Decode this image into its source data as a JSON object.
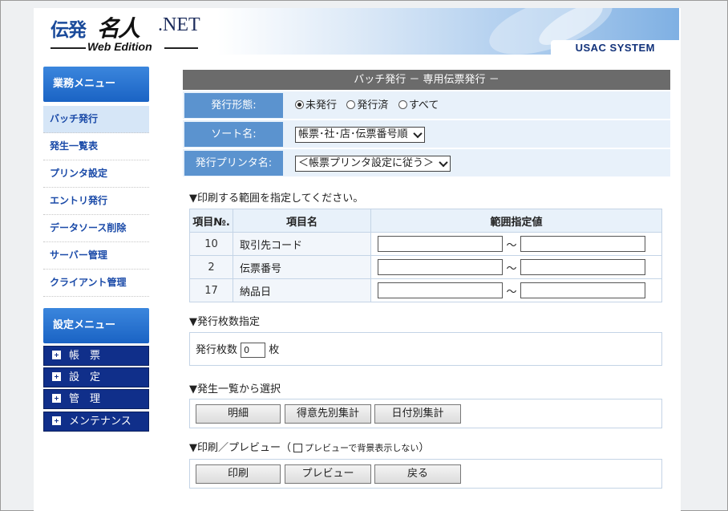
{
  "header": {
    "logo_dept": "伝発",
    "logo_meijin": "名人",
    "logo_net": ".NET",
    "logo_edition": "Web Edition",
    "brand": "USAC SYSTEM"
  },
  "sidebar": {
    "work_menu_title": "業務メニュー",
    "work_items": [
      {
        "label": "バッチ発行",
        "active": true
      },
      {
        "label": "発生一覧表"
      },
      {
        "label": "プリンタ設定"
      },
      {
        "label": "エントリ発行"
      },
      {
        "label": "データソース削除"
      },
      {
        "label": "サーバー管理"
      },
      {
        "label": "クライアント管理"
      }
    ],
    "settings_menu_title": "設定メニュー",
    "settings_items": [
      {
        "label": "帳　票"
      },
      {
        "label": "設　定"
      },
      {
        "label": "管　理"
      },
      {
        "label": "メンテナンス"
      }
    ]
  },
  "main": {
    "title": "バッチ発行 － 専用伝票発行 －",
    "options": {
      "issue_form_label": "発行形態:",
      "issue_radio": [
        "未発行",
        "発行済",
        "すべて"
      ],
      "issue_selected": "未発行",
      "sort_label": "ソート名:",
      "sort_value": "帳票･社･店･伝票番号順",
      "printer_label": "発行プリンタ名:",
      "printer_value": "＜帳票プリンタ設定に従う＞"
    },
    "range_section": "▼印刷する範囲を指定してください。",
    "range_table": {
      "headers": [
        "項目№.",
        "項目名",
        "範囲指定値"
      ],
      "rows": [
        {
          "num": "10",
          "name": "取引先コード",
          "from": "",
          "to": ""
        },
        {
          "num": "2",
          "name": "伝票番号",
          "from": "",
          "to": ""
        },
        {
          "num": "17",
          "name": "納品日",
          "from": "",
          "to": ""
        }
      ],
      "tilde": "～"
    },
    "count_section": "▼発行枚数指定",
    "count_label": "発行枚数",
    "count_value": "0",
    "count_unit": "枚",
    "select_section": "▼発生一覧から選択",
    "select_buttons": [
      "明細",
      "得意先別集計",
      "日付別集計"
    ],
    "print_section_prefix": "▼印刷／プレビュー（",
    "print_checkbox_label": "プレビューで背景表示しない",
    "print_section_suffix": "）",
    "print_buttons": [
      "印刷",
      "プレビュー",
      "戻る"
    ]
  }
}
